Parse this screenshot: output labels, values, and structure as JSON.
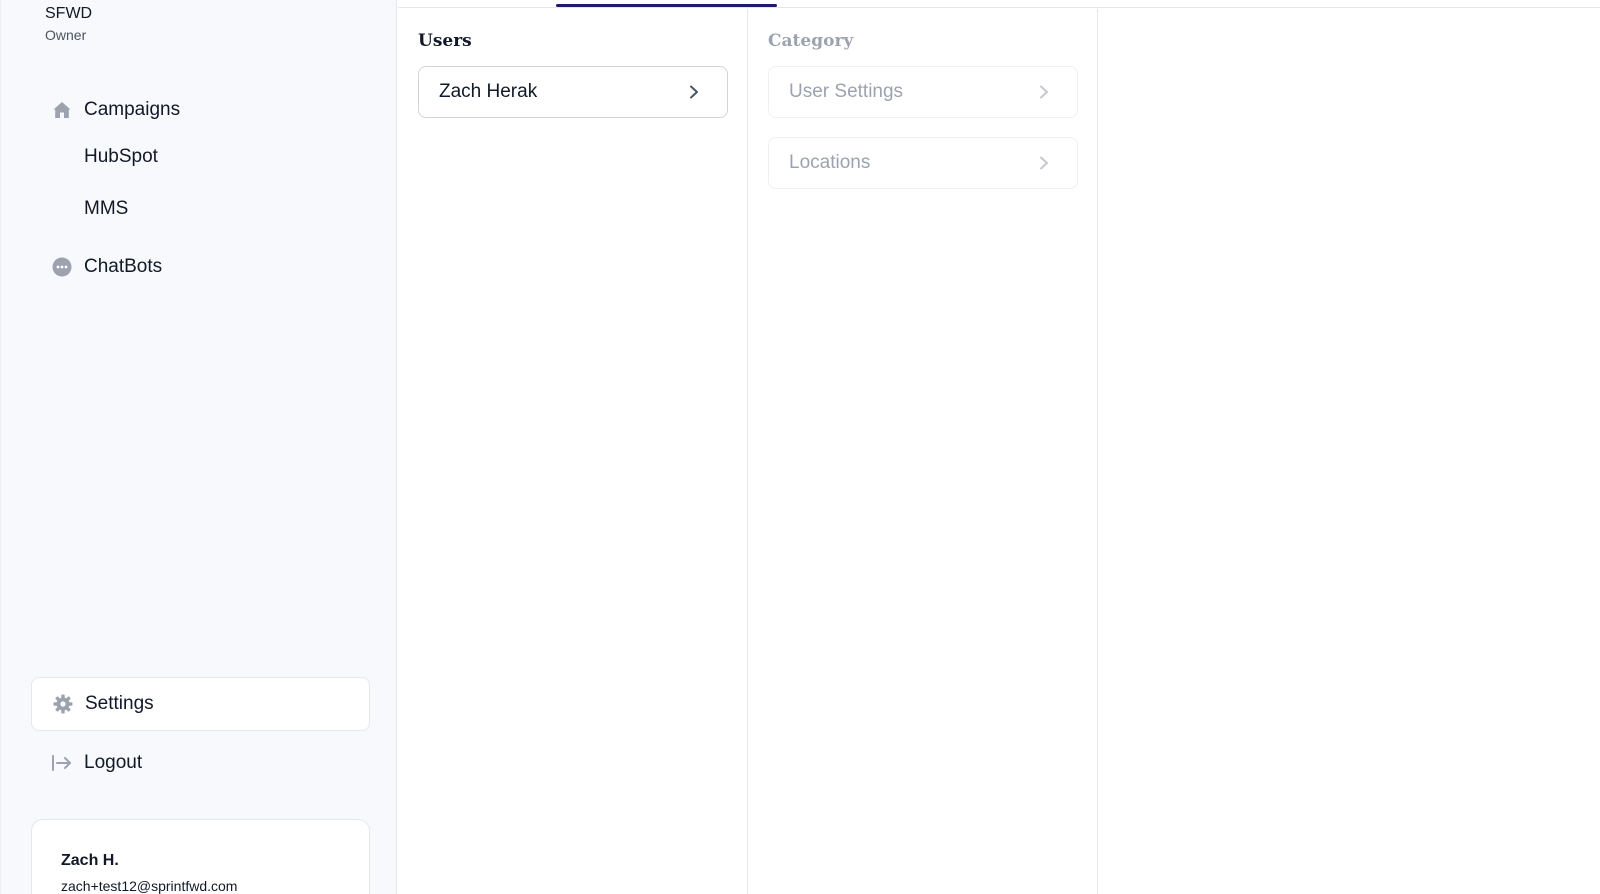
{
  "org": {
    "name": "SFWD",
    "role": "Owner"
  },
  "sidebar": {
    "items": [
      {
        "label": "Campaigns",
        "icon": "home-icon"
      },
      {
        "label": "HubSpot"
      },
      {
        "label": "MMS"
      },
      {
        "label": "ChatBots",
        "icon": "chat-bubble-icon"
      }
    ],
    "settings_label": "Settings",
    "logout_label": "Logout"
  },
  "user": {
    "name": "Zach H.",
    "email": "zach+test12@sprintfwd.com"
  },
  "columns": {
    "users": {
      "title": "Users",
      "items": [
        "Zach Herak"
      ]
    },
    "category": {
      "title": "Category",
      "items": [
        "User Settings",
        "Locations"
      ]
    }
  },
  "colors": {
    "accent": "#1e1b6e",
    "icon": "#9ca3af",
    "muted_text": "#9ca3af"
  }
}
